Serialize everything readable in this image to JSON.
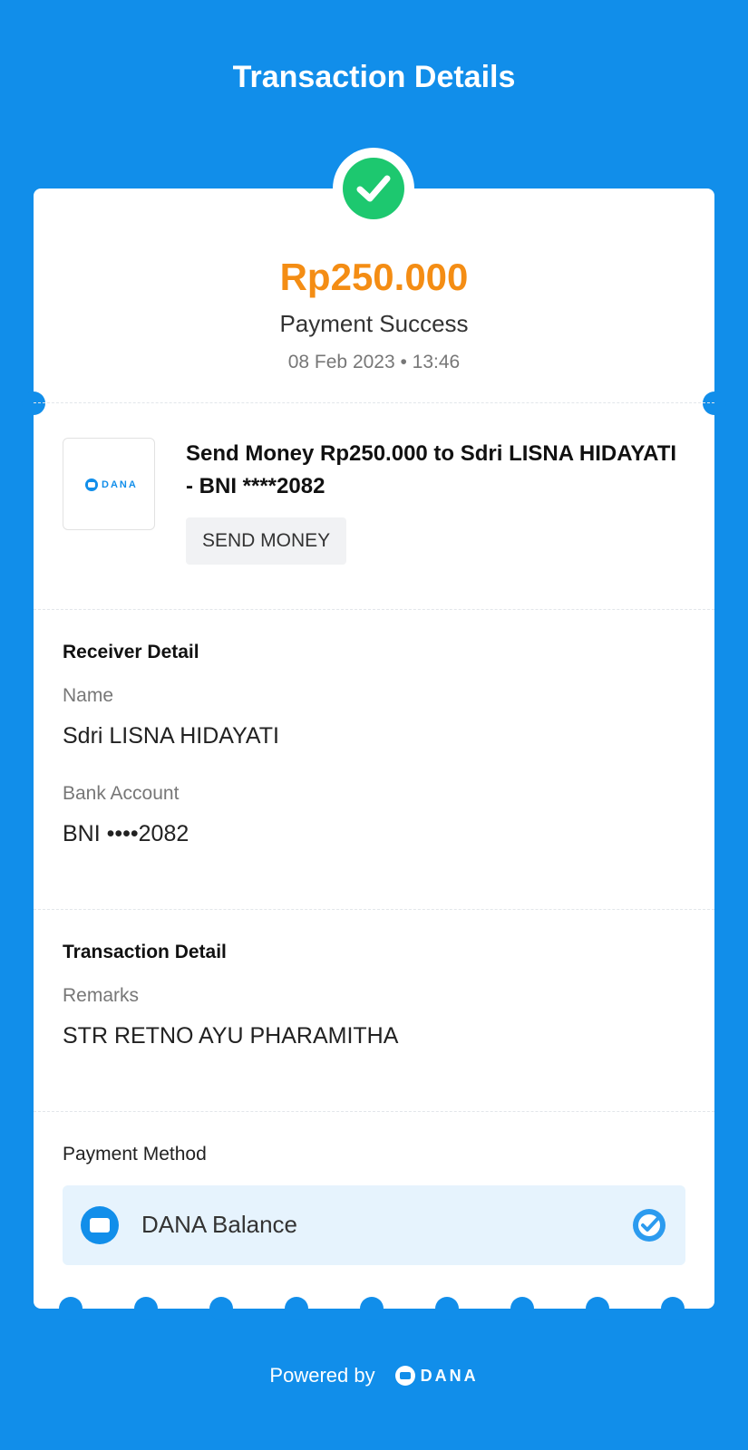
{
  "header": {
    "title": "Transaction Details"
  },
  "summary": {
    "amount": "Rp250.000",
    "status": "Payment Success",
    "datetime": "08 Feb 2023 • 13:46"
  },
  "transaction": {
    "logo_text": "DANA",
    "title": "Send Money Rp250.000 to Sdri LISNA HIDAYATI - BNI ****2082",
    "tag": "SEND MONEY"
  },
  "receiver": {
    "section_title": "Receiver Detail",
    "name_label": "Name",
    "name_value": "Sdri LISNA HIDAYATI",
    "bank_label": "Bank Account",
    "bank_value": "BNI ••••2082"
  },
  "detail": {
    "section_title": "Transaction Detail",
    "remarks_label": "Remarks",
    "remarks_value": "STR RETNO AYU PHARAMITHA"
  },
  "payment": {
    "label": "Payment Method",
    "method": "DANA Balance"
  },
  "footer": {
    "powered_by": "Powered by",
    "brand": "DANA"
  },
  "colors": {
    "background": "#118EEA",
    "amount": "#F48D14",
    "success": "#1DC86F",
    "method_bg": "#E6F3FD"
  }
}
